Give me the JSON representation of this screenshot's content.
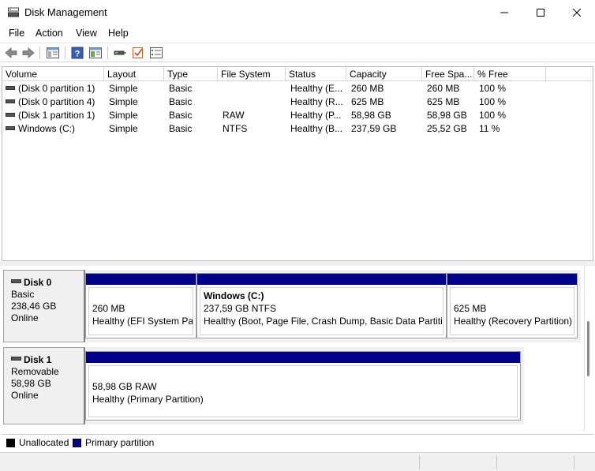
{
  "window": {
    "title": "Disk Management"
  },
  "menu": {
    "file": "File",
    "action": "Action",
    "view": "View",
    "help": "Help"
  },
  "toolbar": {
    "icons": [
      "back-icon",
      "forward-icon",
      "console-tree-icon",
      "help-icon",
      "properties-icon",
      "connect-icon",
      "check-icon",
      "list-view-icon"
    ]
  },
  "columns": {
    "volume": "Volume",
    "layout": "Layout",
    "type": "Type",
    "file_system": "File System",
    "status": "Status",
    "capacity": "Capacity",
    "free_space": "Free Spa...",
    "pct_free": "% Free"
  },
  "volumes": [
    {
      "volume": "(Disk 0 partition 1)",
      "layout": "Simple",
      "type": "Basic",
      "file_system": "",
      "status": "Healthy (E...",
      "capacity": "260 MB",
      "free_space": "260 MB",
      "pct_free": "100 %"
    },
    {
      "volume": "(Disk 0 partition 4)",
      "layout": "Simple",
      "type": "Basic",
      "file_system": "",
      "status": "Healthy (R...",
      "capacity": "625 MB",
      "free_space": "625 MB",
      "pct_free": "100 %"
    },
    {
      "volume": "(Disk 1 partition 1)",
      "layout": "Simple",
      "type": "Basic",
      "file_system": "RAW",
      "status": "Healthy (P...",
      "capacity": "58,98 GB",
      "free_space": "58,98 GB",
      "pct_free": "100 %"
    },
    {
      "volume": "Windows (C:)",
      "layout": "Simple",
      "type": "Basic",
      "file_system": "NTFS",
      "status": "Healthy (B...",
      "capacity": "237,59 GB",
      "free_space": "25,52 GB",
      "pct_free": "11 %"
    }
  ],
  "disks": [
    {
      "name": "Disk 0",
      "type": "Basic",
      "size": "238,46 GB",
      "state": "Online",
      "partitions": [
        {
          "title": "",
          "size": "260 MB",
          "status": "Healthy (EFI System Partition)"
        },
        {
          "title": "Windows  (C:)",
          "size": "237,59 GB NTFS",
          "status": "Healthy (Boot, Page File, Crash Dump, Basic Data Partition)"
        },
        {
          "title": "",
          "size": "625 MB",
          "status": "Healthy (Recovery Partition)"
        }
      ]
    },
    {
      "name": "Disk 1",
      "type": "Removable",
      "size": "58,98 GB",
      "state": "Online",
      "partitions": [
        {
          "title": "",
          "size": "58,98 GB RAW",
          "status": "Healthy (Primary Partition)"
        }
      ]
    }
  ],
  "legend": {
    "unallocated": "Unallocated",
    "primary": "Primary partition"
  },
  "colors": {
    "primary_partition": "#00008b",
    "unallocated": "#000000"
  }
}
